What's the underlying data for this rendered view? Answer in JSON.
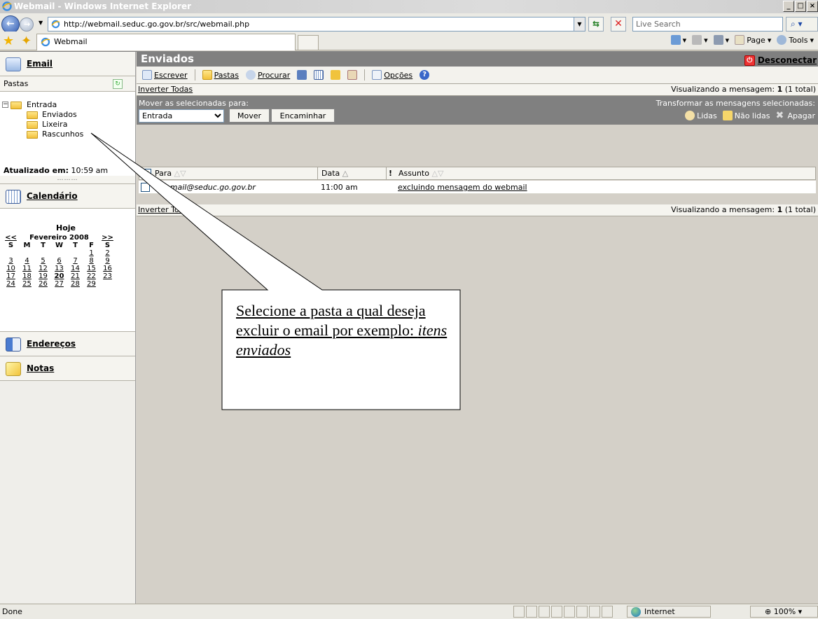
{
  "window": {
    "title": "Webmail - Windows Internet Explorer",
    "controls": [
      "_",
      "□",
      "×"
    ]
  },
  "browser": {
    "address": "http://webmail.seduc.go.gov.br/src/webmail.php",
    "search_placeholder": "Live Search",
    "tab_title": "Webmail",
    "cmd_page": "Page",
    "cmd_tools": "Tools",
    "status_text": "Done",
    "zone": "Internet",
    "zoom": "100%"
  },
  "sidebar": {
    "email_label": "Email",
    "pastas_label": "Pastas",
    "folders": [
      {
        "label": "Entrada"
      },
      {
        "label": "Enviados"
      },
      {
        "label": "Lixeira"
      },
      {
        "label": "Rascunhos"
      }
    ],
    "updated_label": "Atualizado em:",
    "updated_time": "10:59 am",
    "calendar_label": "Calendário",
    "calendar": {
      "today_label": "Hoje",
      "prev": "<<",
      "month": "Fevereiro 2008",
      "next": ">>",
      "weekdays": [
        "S",
        "M",
        "T",
        "W",
        "T",
        "F",
        "S"
      ],
      "weeks": [
        [
          "",
          "",
          "",
          "",
          "",
          "1",
          "2"
        ],
        [
          "3",
          "4",
          "5",
          "6",
          "7",
          "8",
          "9"
        ],
        [
          "10",
          "11",
          "12",
          "13",
          "14",
          "15",
          "16"
        ],
        [
          "17",
          "18",
          "19",
          "20",
          "21",
          "22",
          "23"
        ],
        [
          "24",
          "25",
          "26",
          "27",
          "28",
          "29",
          ""
        ]
      ],
      "today": "20"
    },
    "addresses_label": "Endereços",
    "notes_label": "Notas"
  },
  "main": {
    "title": "Enviados",
    "logout_label": "Desconectar",
    "toolbar": {
      "compose": "Escrever",
      "folders": "Pastas",
      "search": "Procurar",
      "options": "Opções"
    },
    "invert_all": "Inverter Todas",
    "viewing_prefix": "Visualizando a mensagem:",
    "viewing_count": "1",
    "viewing_total": "(1 total)",
    "move_label": "Mover as selecionadas para:",
    "move_target": "Entrada",
    "move_button": "Mover",
    "forward_button": "Encaminhar",
    "transform_label": "Transformar as mensagens selecionadas:",
    "action_read": "Lidas",
    "action_unread": "Não lidas",
    "action_delete": "Apagar",
    "columns": {
      "to": "Para",
      "date": "Data",
      "subject": "Assunto"
    },
    "message": {
      "to": "webmail@seduc.go.gov.br",
      "date": "11:00 am",
      "subject": "excluindo mensagem do webmail"
    }
  },
  "callout": {
    "text_plain": "Selecione a pasta a qual deseja excluir o email por exemplo: ",
    "text_italic": "itens enviados"
  },
  "colors": {
    "title_bar": "#808080",
    "folder_yellow": "#f2c13c"
  }
}
